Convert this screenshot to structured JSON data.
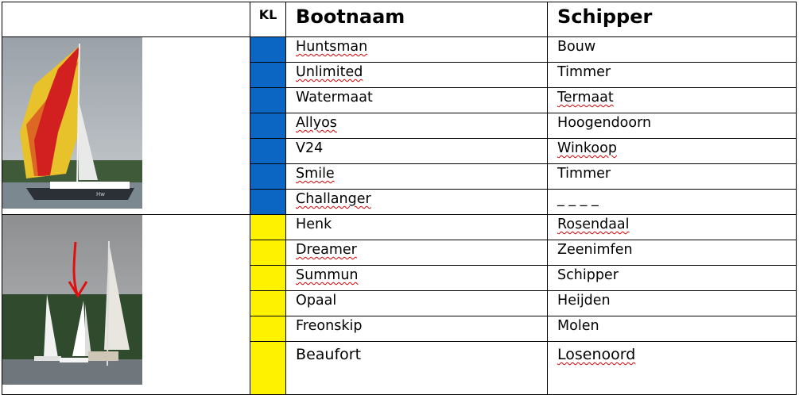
{
  "headers": {
    "kl": "KL",
    "bootnaam": "Bootnaam",
    "schipper": "Schipper"
  },
  "colors": {
    "blue": "#0a66c2",
    "yellow": "#fff200",
    "spellcheck": "#d40000"
  },
  "groups": [
    {
      "kl_color": "blue",
      "photo_icon": "red-yellow-spinnaker-sailboat-photo",
      "rows": [
        {
          "boot": "Huntsman",
          "schipper": "Bouw"
        },
        {
          "boot": "Unlimited",
          "schipper": "Timmer"
        },
        {
          "boot": "Watermaat",
          "schipper": "Termaat"
        },
        {
          "boot": "Allyos",
          "schipper": "Hoogendoorn"
        },
        {
          "boot": "V24",
          "schipper": "Winkoop"
        },
        {
          "boot": "Smile",
          "schipper": "Timmer"
        },
        {
          "boot": "Challanger",
          "schipper": "_ _ _ _"
        }
      ]
    },
    {
      "kl_color": "yellow",
      "photo_icon": "sailboats-with-red-arrow-photo",
      "rows": [
        {
          "boot": "Henk",
          "schipper": "Rosendaal"
        },
        {
          "boot": "Dreamer",
          "schipper": "Zeenimfen"
        },
        {
          "boot": "Summun",
          "schipper": "Schipper"
        },
        {
          "boot": "Opaal",
          "schipper": "Heijden"
        },
        {
          "boot": "Freonskip",
          "schipper": "Molen"
        },
        {
          "boot": "Beaufort",
          "schipper": "Losenoord"
        }
      ]
    }
  ]
}
